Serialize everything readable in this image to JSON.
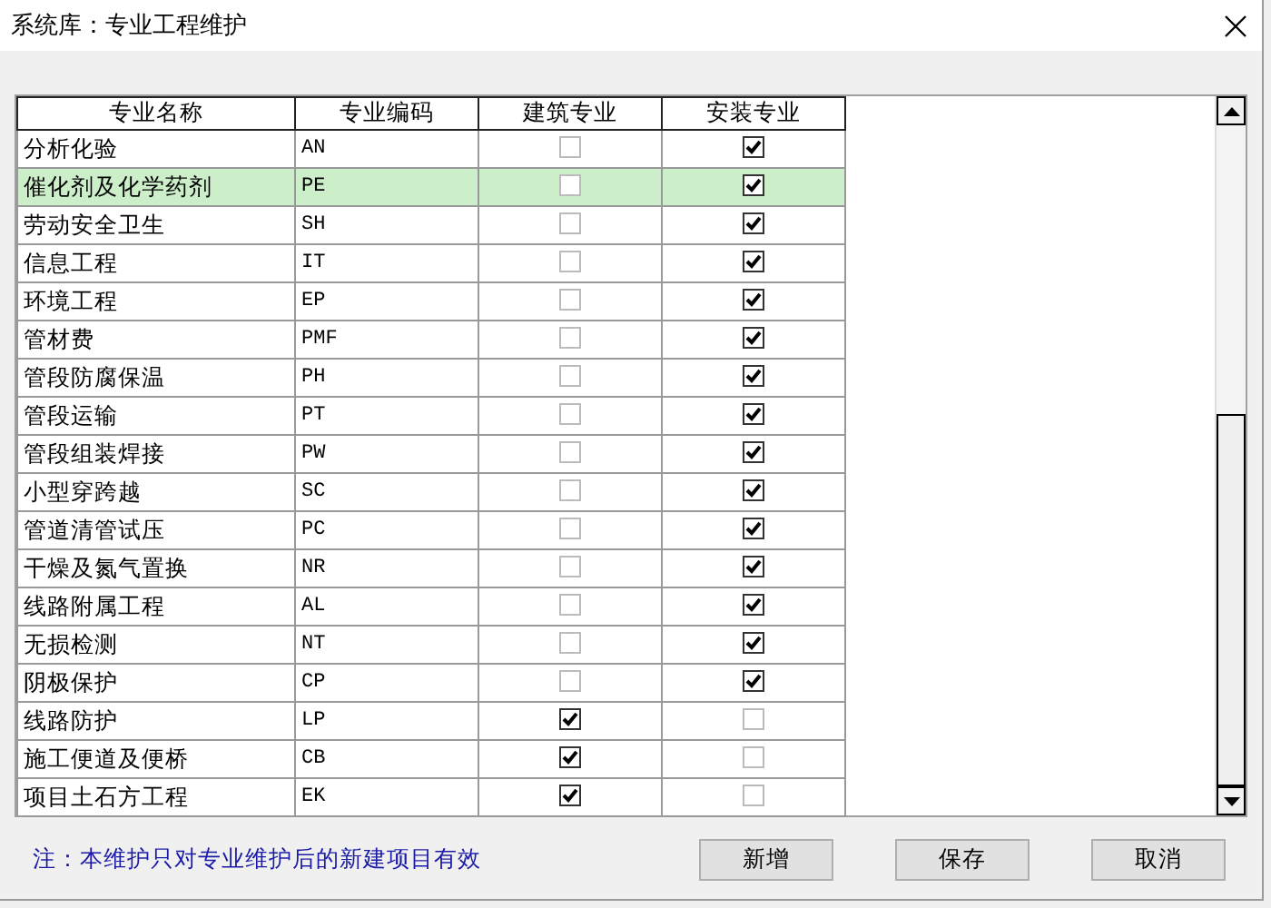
{
  "window": {
    "title": "系统库：专业工程维护"
  },
  "table": {
    "columns": [
      "专业名称",
      "专业编码",
      "建筑专业",
      "安装专业"
    ],
    "rows": [
      {
        "name": "分析化验",
        "code": "AN",
        "building": false,
        "installation": true,
        "selected": false
      },
      {
        "name": "催化剂及化学药剂",
        "code": "PE",
        "building": false,
        "installation": true,
        "selected": true
      },
      {
        "name": "劳动安全卫生",
        "code": "SH",
        "building": false,
        "installation": true,
        "selected": false
      },
      {
        "name": "信息工程",
        "code": "IT",
        "building": false,
        "installation": true,
        "selected": false
      },
      {
        "name": "环境工程",
        "code": "EP",
        "building": false,
        "installation": true,
        "selected": false
      },
      {
        "name": "管材费",
        "code": "PMF",
        "building": false,
        "installation": true,
        "selected": false
      },
      {
        "name": "管段防腐保温",
        "code": "PH",
        "building": false,
        "installation": true,
        "selected": false
      },
      {
        "name": "管段运输",
        "code": "PT",
        "building": false,
        "installation": true,
        "selected": false
      },
      {
        "name": "管段组装焊接",
        "code": "PW",
        "building": false,
        "installation": true,
        "selected": false
      },
      {
        "name": "小型穿跨越",
        "code": "SC",
        "building": false,
        "installation": true,
        "selected": false
      },
      {
        "name": "管道清管试压",
        "code": "PC",
        "building": false,
        "installation": true,
        "selected": false
      },
      {
        "name": "干燥及氮气置换",
        "code": "NR",
        "building": false,
        "installation": true,
        "selected": false
      },
      {
        "name": "线路附属工程",
        "code": "AL",
        "building": false,
        "installation": true,
        "selected": false
      },
      {
        "name": "无损检测",
        "code": "NT",
        "building": false,
        "installation": true,
        "selected": false
      },
      {
        "name": "阴极保护",
        "code": "CP",
        "building": false,
        "installation": true,
        "selected": false
      },
      {
        "name": "线路防护",
        "code": "LP",
        "building": true,
        "installation": false,
        "selected": false
      },
      {
        "name": "施工便道及便桥",
        "code": "CB",
        "building": true,
        "installation": false,
        "selected": false
      },
      {
        "name": "项目土石方工程",
        "code": "EK",
        "building": true,
        "installation": false,
        "selected": false
      }
    ]
  },
  "note": "注：本维护只对专业维护后的新建项目有效",
  "buttons": [
    "新增",
    "保存",
    "取消"
  ]
}
